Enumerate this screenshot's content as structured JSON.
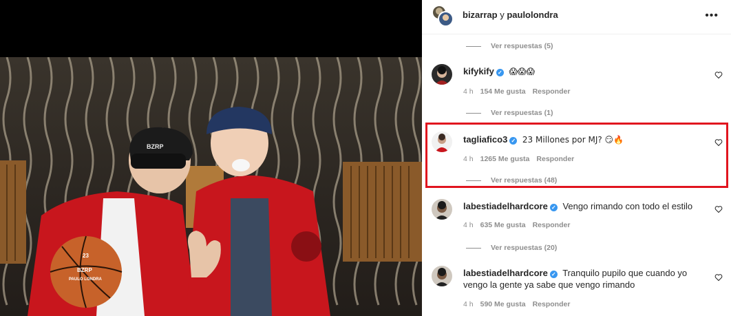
{
  "header": {
    "user1": "bizarrap",
    "conjunction": "y",
    "user2": "paulolondra",
    "more_icon": "more-horizontal-icon"
  },
  "replies_top": {
    "label": "Ver respuestas (5)"
  },
  "comments": [
    {
      "username": "kifykify",
      "verified": true,
      "text": "😱😱😱",
      "time": "4 h",
      "likes": "154 Me gusta",
      "reply": "Responder",
      "replies_label": "Ver respuestas (1)"
    },
    {
      "username": "tagliafico3",
      "verified": true,
      "text": "23 Millones por MJ? 😏🔥",
      "time": "4 h",
      "likes": "1265 Me gusta",
      "reply": "Responder",
      "replies_label": "Ver respuestas (48)"
    },
    {
      "username": "labestiadelhardcore",
      "verified": true,
      "text": "Vengo rimando con todo el estilo",
      "time": "4 h",
      "likes": "635 Me gusta",
      "reply": "Responder",
      "replies_label": "Ver respuestas (20)"
    },
    {
      "username": "labestiadelhardcore",
      "verified": true,
      "text": "Tranquilo pupilo que cuando yo vengo la gente ya sabe que vengo rimando",
      "time": "4 h",
      "likes": "590 Me gusta",
      "reply": "Responder"
    }
  ],
  "photo": {
    "cap_text": "BZRP",
    "ball_text_1": "BZRP",
    "ball_text_2": "PAULO LONDRA",
    "ball_number": "23"
  },
  "colors": {
    "highlight": "#e1141e",
    "verified": "#3897f0",
    "muted": "#8e8e8e",
    "jacket": "#c8161d"
  }
}
